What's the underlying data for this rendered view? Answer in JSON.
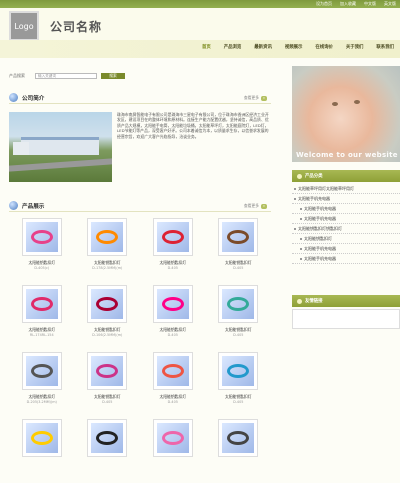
{
  "header": {
    "top_links": [
      "设为首页",
      "加入收藏",
      "中文版",
      "英文版"
    ],
    "logo_text": "Logo",
    "company_name": "公司名称"
  },
  "nav": [
    "首页",
    "产品浏览",
    "最新资讯",
    "视频展示",
    "在线询价",
    "关于我们",
    "联系我们"
  ],
  "search": {
    "label": "产品搜索",
    "placeholder": "输入关键词",
    "button": "搜索"
  },
  "intro": {
    "title": "公司简介",
    "more": "查看更多",
    "text": "珠海市南屏智能电子有限公司是珠海市三星电子有限公司，位于珠海市香洲区经济工业开发区，建设项目在的整体环境和原材料。连接生产能力配置优越，坚持诚信，高品质、优质产品大规模，太阳能手电筒，太阳能垃圾桶，太阳能草坪灯，太阳能庭院灯，LED灯，LED节能灯等产品，深受客户好评。公司本着诚信为本，以质量求生存，以信誉求发展的经营宗旨，欢迎广大客户光临指导，洽谈业务。"
  },
  "products": {
    "title": "产品展示",
    "more": "查看更多",
    "items": [
      {
        "name": "太阳能钥匙扣灯",
        "code": "D-405(c)"
      },
      {
        "name": "太阳能钥匙扣灯",
        "code": "D-178(2.5MM)(m)"
      },
      {
        "name": "太阳能钥匙扣灯",
        "code": "D-405"
      },
      {
        "name": "太阳能钥匙扣灯",
        "code": "D-405"
      },
      {
        "name": "太阳能钥匙扣灯",
        "code": "RL-174RL-154"
      },
      {
        "name": "太阳能钥匙扣灯",
        "code": "D-106(2.5MM)(m)"
      },
      {
        "name": "太阳能钥匙扣灯",
        "code": "D-405"
      },
      {
        "name": "太阳能钥匙扣灯",
        "code": "D-405"
      },
      {
        "name": "太阳能钥匙扣灯",
        "code": "D-205(3.2MM)(m)"
      },
      {
        "name": "太阳能钥匙扣灯",
        "code": "D-405"
      },
      {
        "name": "太阳能钥匙扣灯",
        "code": "D-405"
      },
      {
        "name": "太阳能钥匙扣灯",
        "code": "D-405"
      },
      {
        "name": "",
        "code": ""
      },
      {
        "name": "",
        "code": ""
      },
      {
        "name": "",
        "code": ""
      },
      {
        "name": "",
        "code": ""
      }
    ]
  },
  "banner": {
    "text": "Welcome to our website"
  },
  "categories": {
    "title": "产品分类",
    "items": [
      {
        "label": "太阳能草坪用灯太阳能草坪用灯",
        "sub": false
      },
      {
        "label": "太阳能手机充电器",
        "sub": false
      },
      {
        "label": "太阳能手机充电器",
        "sub": true
      },
      {
        "label": "太阳能手机充电器",
        "sub": true
      },
      {
        "label": "太阳能钥匙扣灯钥匙扣灯",
        "sub": false
      },
      {
        "label": "太阳能钥匙扣灯",
        "sub": true
      },
      {
        "label": "太阳能手机充电器",
        "sub": true
      },
      {
        "label": "太阳能手机充电器",
        "sub": true
      }
    ]
  },
  "links_panel": {
    "title": "友情链接"
  },
  "colors": {
    "accent": "#8ea037",
    "topbar": "#7f9a3e"
  }
}
